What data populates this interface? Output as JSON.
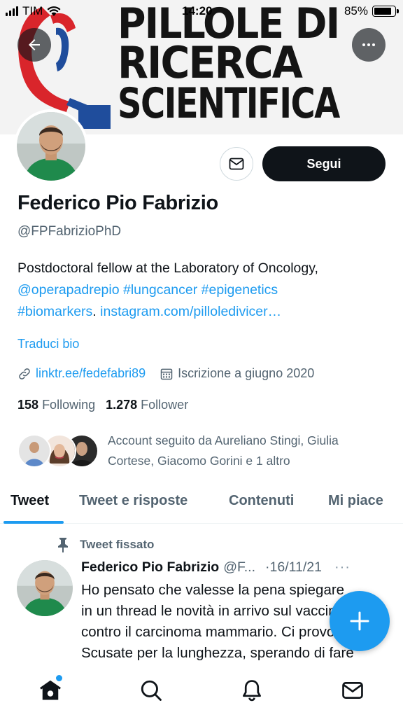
{
  "status_bar": {
    "carrier": "TIM",
    "time": "14:20",
    "battery_percent": "85%",
    "battery_level": 0.85
  },
  "banner": {
    "line1": "PILLOLE DI",
    "line2": "RICERCA",
    "line3": "SCIENTIFICA",
    "accent_color": "#e5202d"
  },
  "header": {
    "back_icon": "arrow-left-icon",
    "more_icon": "more-horizontal-icon"
  },
  "profile": {
    "name": "Federico Pio Fabrizio",
    "handle": "@FPFabrizioPhD",
    "follow_label": "Segui",
    "message_icon": "mail-icon",
    "bio_text": "Postdoctoral fellow at the Laboratory of Oncology,",
    "bio_mention": "@operapadrepio",
    "bio_tag1": "#lungcancer",
    "bio_tag2": "#epigenetics",
    "bio_tag3": "#biomarkers",
    "bio_link": "instagram.com/pilloledivicer…",
    "translate_label": "Traduci bio",
    "website": "linktr.ee/fedefabri89",
    "joined": "Iscrizione a giugno 2020",
    "following_count": "158",
    "following_label": "Following",
    "followers_count": "1.278",
    "followers_label": "Follower",
    "followed_by": "Account seguito da Aureliano Stingi, Giulia Cortese, Giacomo Gorini e 1 altro"
  },
  "tabs": [
    {
      "label": "Tweet",
      "active": true
    },
    {
      "label": "Tweet e risposte",
      "active": false
    },
    {
      "label": "Contenuti",
      "active": false
    },
    {
      "label": "Mi piace",
      "active": false
    }
  ],
  "tweet": {
    "pinned_label": "Tweet fissato",
    "author": "Federico Pio Fabrizio",
    "handle": "@F...",
    "date": "·16/11/21",
    "more": "···",
    "text": "Ho pensato che valesse la pena spiegare\nin un thread le novità in arrivo sul vaccino\ncontro il carcinoma mammario. Ci provo!\nScusate per la lunghezza, sperando di fare"
  },
  "fab": {
    "icon": "plus-icon"
  },
  "bottom_nav": {
    "items": [
      "home-icon",
      "search-icon",
      "notifications-icon",
      "messages-icon"
    ]
  },
  "colors": {
    "accent": "#1d9bf0",
    "text": "#0f1419",
    "secondary": "#536471"
  }
}
